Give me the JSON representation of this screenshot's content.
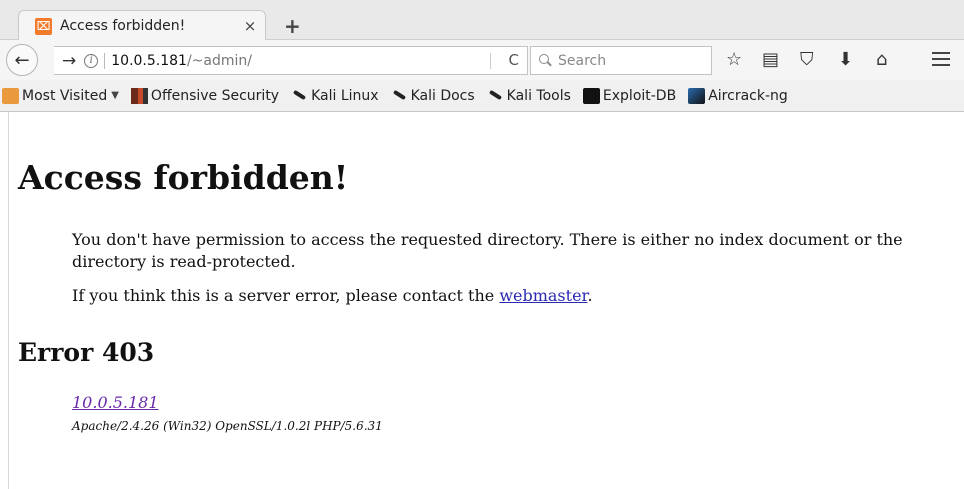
{
  "browser": {
    "tab": {
      "title": "Access forbidden!",
      "close": "×",
      "favicon_icon": "xampp-icon"
    },
    "new_tab": "+",
    "nav": {
      "back": "←",
      "forward": "→",
      "url_host": "10.0.5.181",
      "url_path": "/~admin/",
      "reload": "C",
      "search_placeholder": "Search"
    },
    "toolbar": {
      "bookmark_star": "☆",
      "reading_list": "▤",
      "pocket": "⛉",
      "downloads": "⬇",
      "home": "⌂"
    },
    "bookmarks": [
      {
        "label": "Most Visited",
        "icon": "folder-icon"
      },
      {
        "label": "Offensive Security",
        "icon": "offsec-icon"
      },
      {
        "label": "Kali Linux",
        "icon": "kali-icon"
      },
      {
        "label": "Kali Docs",
        "icon": "kali-icon"
      },
      {
        "label": "Kali Tools",
        "icon": "kali-icon"
      },
      {
        "label": "Exploit-DB",
        "icon": "exploitdb-icon"
      },
      {
        "label": "Aircrack-ng",
        "icon": "aircrack-icon"
      }
    ]
  },
  "content": {
    "title": "Access forbidden!",
    "description": "You don't have permission to access the requested directory. There is either no index document or the directory is read-protected.",
    "contact_prefix": "If you think this is a server error, please contact the ",
    "contact_link": "webmaster",
    "contact_suffix": ".",
    "error_heading": "Error 403",
    "host_link": "10.0.5.181",
    "server_signature": "Apache/2.4.26 (Win32) OpenSSL/1.0.2l PHP/5.6.31"
  },
  "colors": {
    "link": "#2a2ab0",
    "visited_link": "#6a2aa8",
    "favicon": "#f27a2a"
  }
}
